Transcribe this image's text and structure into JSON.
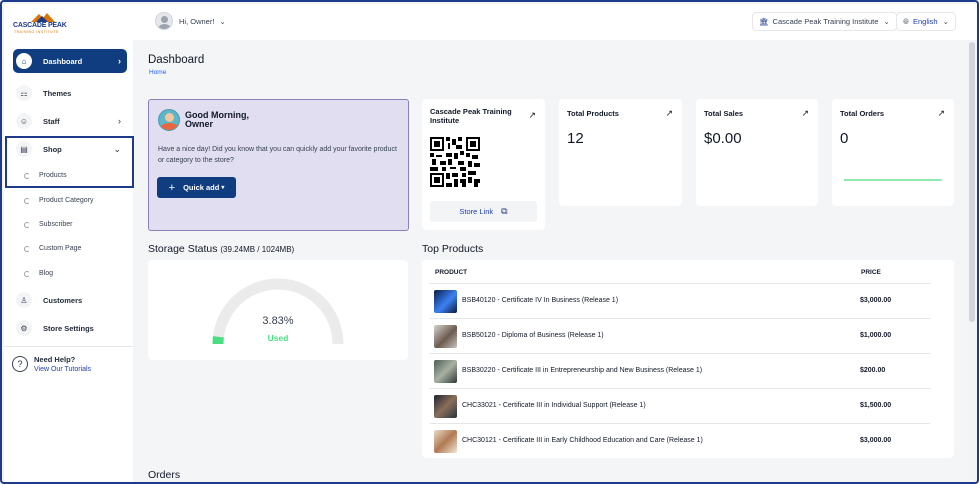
{
  "brand": {
    "name": "CASCADE PEAK",
    "tagline": "TRAINING INSTITUTE"
  },
  "sidebar": {
    "items": [
      {
        "label": "Dashboard",
        "icon": "home-icon"
      },
      {
        "label": "Themes",
        "icon": "themes-icon"
      },
      {
        "label": "Staff",
        "icon": "staff-icon"
      },
      {
        "label": "Shop",
        "icon": "shop-icon"
      },
      {
        "label": "Customers",
        "icon": "customers-icon"
      },
      {
        "label": "Store Settings",
        "icon": "settings-icon"
      }
    ],
    "shop_sub": [
      "Products",
      "Product Category",
      "Subscriber",
      "Custom Page",
      "Blog"
    ],
    "help": {
      "title": "Need Help?",
      "link": "View Our Tutorials"
    }
  },
  "topbar": {
    "greeting": "Hi, Owner!",
    "store": "Cascade Peak Training Institute",
    "language": "English"
  },
  "page": {
    "title": "Dashboard",
    "breadcrumb": "Home"
  },
  "greeting_card": {
    "line1": "Good Morning,",
    "line2": "Owner",
    "message": "Have a nice day! Did you know that you can quickly add your favorite product or category to the store?",
    "button": "Quick add"
  },
  "qr_card": {
    "title": "Cascade Peak Training Institute",
    "link": "Store Link"
  },
  "stats": [
    {
      "label": "Total Products",
      "value": "12"
    },
    {
      "label": "Total Sales",
      "value": "$0.00"
    },
    {
      "label": "Total Orders",
      "value": "0"
    }
  ],
  "storage": {
    "title": "Storage Status",
    "detail": "(39.24MB / 1024MB)",
    "percent": 3.83,
    "percent_text": "3.83%",
    "used_label": "Used"
  },
  "top_products": {
    "title": "Top Products",
    "columns": [
      "PRODUCT",
      "PRICE"
    ],
    "rows": [
      {
        "name": "BSB40120 - Certificate IV In Business (Release 1)",
        "price": "$3,000.00"
      },
      {
        "name": "BSB50120 - Diploma of Business (Release 1)",
        "price": "$1,000.00"
      },
      {
        "name": "BSB30220 - Certificate III in Entrepreneurship and New Business (Release 1)",
        "price": "$200.00"
      },
      {
        "name": "CHC33021 - Certificate III in Individual Support (Release 1)",
        "price": "$1,500.00"
      },
      {
        "name": "CHC30121 - Certificate III in Early Childhood Education and Care (Release 1)",
        "price": "$3,000.00"
      }
    ]
  },
  "orders": {
    "title": "Orders"
  },
  "colors": {
    "primary": "#0f3d80",
    "accent_green": "#4ade80",
    "greeting_bg": "#e0def0"
  }
}
